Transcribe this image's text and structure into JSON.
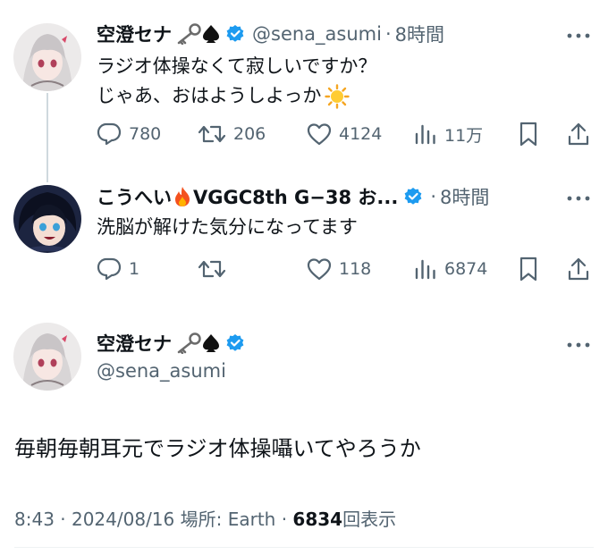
{
  "tweets": [
    {
      "name": "空澄セナ",
      "handle": "@sena_asumi",
      "sep": "·",
      "time": "8時間",
      "lines": [
        "ラジオ体操なくて寂しいですか？",
        "じゃあ、おはようしよっか"
      ],
      "reply": "780",
      "retweet": "206",
      "like": "4124",
      "views": "11万"
    },
    {
      "name": "こうへい",
      "name_suffix": "VGGC8th G−38 お...",
      "sep": "·",
      "time": "8時間",
      "lines": [
        "洗脳が解けた気分になってます"
      ],
      "reply": "1",
      "retweet": "",
      "like": "118",
      "views": "6874"
    }
  ],
  "main_tweet": {
    "name": "空澄セナ",
    "handle": "@sena_asumi",
    "text": "毎朝毎朝耳元でラジオ体操囁いてやろうか",
    "meta_prefix": "8:43 · 2024/08/16 場所: Earth · ",
    "views_count": "6834",
    "views_label": "回表示"
  },
  "icons": [
    "key-icon",
    "spade-icon",
    "verified-badge-icon",
    "fire-icon",
    "sun-icon",
    "more-icon",
    "reply-icon",
    "retweet-icon",
    "like-icon",
    "views-icon",
    "bookmark-icon",
    "share-icon"
  ],
  "colors": {
    "verified": "#1d9bf0",
    "secondary_text": "#536471",
    "thread_line": "#cfd9de",
    "text": "#0f1419"
  }
}
